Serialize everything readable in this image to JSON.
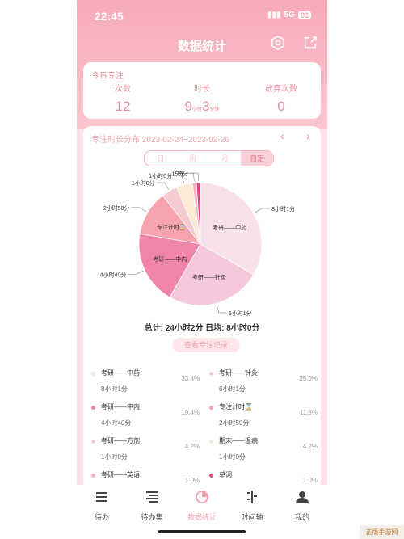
{
  "status_bar": {
    "time": "22:45",
    "network": "5G",
    "battery": "83"
  },
  "header": {
    "title": "数据统计"
  },
  "today": {
    "heading": "今日专注",
    "count": {
      "label": "次数",
      "value": "12"
    },
    "duration": {
      "label": "时长",
      "hours": "9",
      "hours_unit": "小时",
      "minutes": "3",
      "minutes_unit": "分钟"
    },
    "abandon": {
      "label": "放弃次数",
      "value": "0"
    }
  },
  "distribution": {
    "heading": "专注时长分布 2023-02-24~2023-02-26",
    "segments": [
      "日",
      "周",
      "月",
      "自定"
    ],
    "active_segment": "自定",
    "summary": "总计: 24小时2分  日均: 8小时0分",
    "view_records": "查看专注记录"
  },
  "chart_data": {
    "type": "pie",
    "slices": [
      {
        "name": "考研——中药",
        "value": 481,
        "percent": 33.4,
        "color": "#f8e2ea",
        "label": "8小时1分"
      },
      {
        "name": "考研——针灸",
        "value": 361,
        "percent": 25.0,
        "color": "#f5c8dc",
        "label": "6小时1分"
      },
      {
        "name": "考研——中内",
        "value": 280,
        "percent": 19.4,
        "color": "#ef85ab",
        "label": "4小时40分"
      },
      {
        "name": "专注计时⌛",
        "value": 170,
        "percent": 11.8,
        "color": "#f6a3ae",
        "label": "2小时50分"
      },
      {
        "name": "考研——方剂",
        "value": 61,
        "percent": 4.2,
        "color": "#f5cbd0",
        "label": "1小时0分"
      },
      {
        "name": "期末——温病",
        "value": 61,
        "percent": 4.2,
        "color": "#fbead4",
        "label": "1小时0分"
      },
      {
        "name": "考研——英语",
        "value": 15,
        "percent": 1.0,
        "color": "#f3b0c0",
        "label": "15分"
      },
      {
        "name": "单词",
        "value": 15,
        "percent": 1.0,
        "color": "#d94a86",
        "label": "15分"
      }
    ]
  },
  "legend": [
    {
      "name": "考研——中药",
      "duration": "8小时1分",
      "percent": "33.4%",
      "color": "#f8e2ea"
    },
    {
      "name": "考研——针灸",
      "duration": "6小时1分",
      "percent": "25.0%",
      "color": "#f5c8dc"
    },
    {
      "name": "考研——中内",
      "duration": "4小时40分",
      "percent": "19.4%",
      "color": "#ef85ab"
    },
    {
      "name": "专注计时⌛",
      "duration": "2小时50分",
      "percent": "11.8%",
      "color": "#f6a3ae"
    },
    {
      "name": "考研——方剂",
      "duration": "1小时0分",
      "percent": "4.2%",
      "color": "#f5cbd0"
    },
    {
      "name": "期末——温病",
      "duration": "1小时0分",
      "percent": "4.2%",
      "color": "#fbead4"
    },
    {
      "name": "考研——英语",
      "duration": "",
      "percent": "1.0%",
      "color": "#f3b0c0"
    },
    {
      "name": "单词",
      "duration": "",
      "percent": "1.0%",
      "color": "#d94a86"
    }
  ],
  "tabbar": [
    {
      "label": "待办",
      "icon": "todo-list-icon"
    },
    {
      "label": "待办集",
      "icon": "todo-collection-icon"
    },
    {
      "label": "数据统计",
      "icon": "statistics-pie-icon",
      "active": true
    },
    {
      "label": "时间轴",
      "icon": "timeline-icon"
    },
    {
      "label": "我的",
      "icon": "profile-icon"
    }
  ],
  "watermark": "正版手游网"
}
